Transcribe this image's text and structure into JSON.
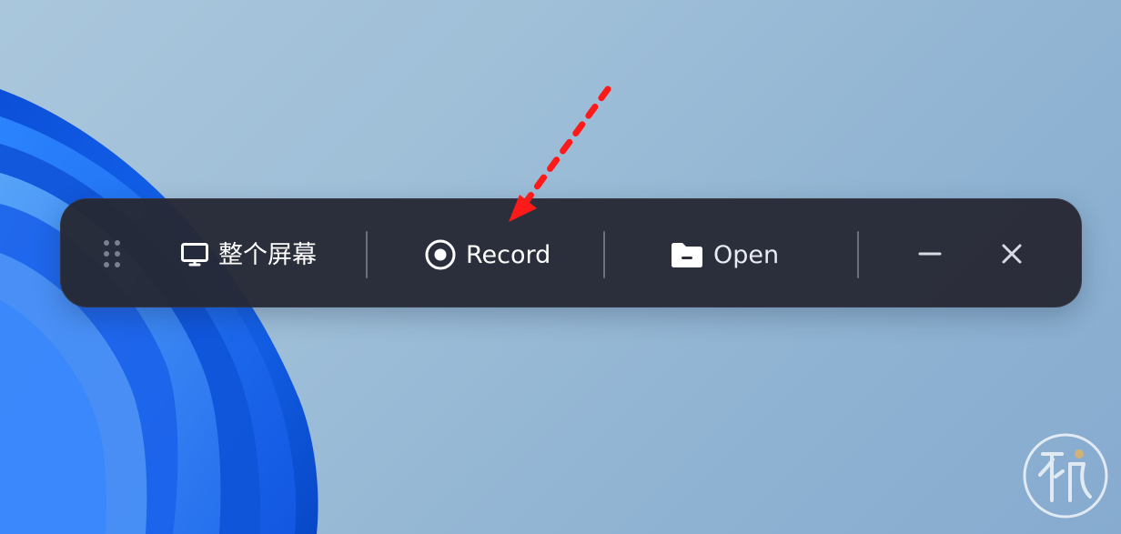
{
  "toolbar": {
    "mode_label": "整个屏幕",
    "record_label": "Record",
    "open_label": "Open"
  },
  "colors": {
    "toolbar_bg": "#262934",
    "text": "#ffffff",
    "annotation_arrow": "#ff1a1a",
    "wallpaper_blue": "#1f64e8"
  },
  "icons": {
    "drag": "drag-handle-icon",
    "screen": "monitor-icon",
    "record": "record-circle-icon",
    "open": "folder-icon",
    "minimize": "minimize-icon",
    "close": "close-icon"
  }
}
